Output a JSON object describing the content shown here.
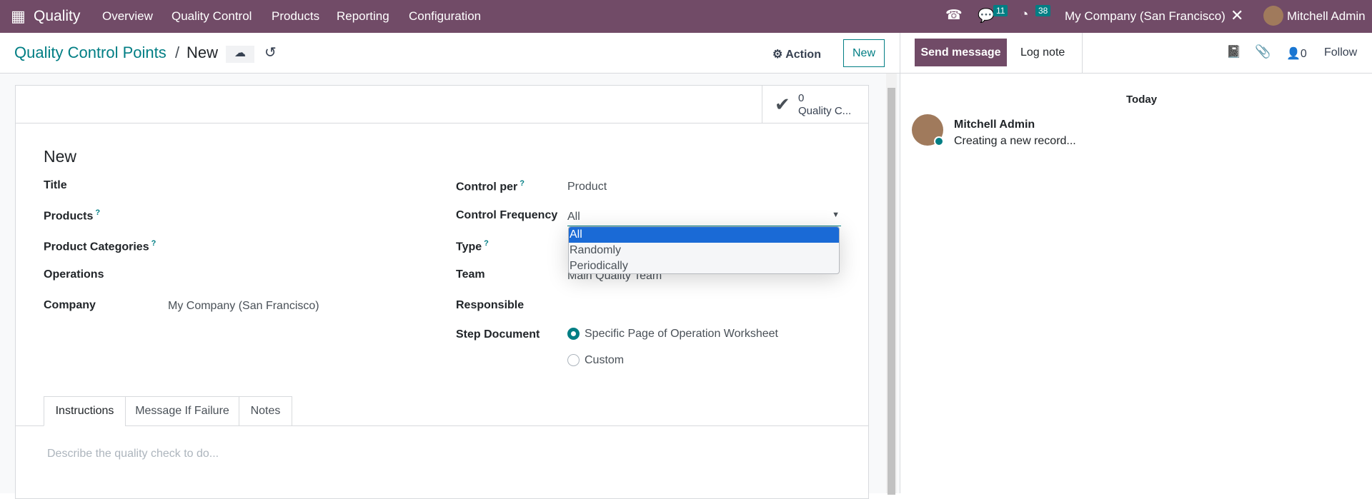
{
  "topbar": {
    "app": "Quality",
    "menu": [
      "Overview",
      "Quality Control",
      "Products",
      "Reporting",
      "Configuration"
    ],
    "messages_count": "11",
    "activities_count": "38",
    "company": "My Company (San Francisco)",
    "user": "Mitchell Admin"
  },
  "breadcrumb": {
    "parent": "Quality Control Points",
    "current": "New"
  },
  "actions": {
    "action": "Action",
    "new": "New"
  },
  "stat": {
    "count": "0",
    "label": "Quality C..."
  },
  "form": {
    "title": "New",
    "left": [
      {
        "label": "Title",
        "value": ""
      },
      {
        "label": "Products",
        "help": "?",
        "value": ""
      },
      {
        "label": "Product Categories",
        "help": "?",
        "value": ""
      },
      {
        "label": "Operations",
        "value": ""
      },
      {
        "label": "Company",
        "value": "My Company (San Francisco)"
      }
    ],
    "right": {
      "control_per": {
        "label": "Control per",
        "help": "?",
        "value": "Product"
      },
      "control_frequency": {
        "label": "Control Frequency",
        "value": "All",
        "options": [
          "All",
          "Randomly",
          "Periodically"
        ],
        "selected": "All"
      },
      "type": {
        "label": "Type",
        "help": "?"
      },
      "team": {
        "label": "Team",
        "value": "Main Quality Team"
      },
      "responsible": {
        "label": "Responsible",
        "value": ""
      },
      "step_document": {
        "label": "Step Document",
        "options": [
          "Specific Page of Operation Worksheet",
          "Custom"
        ],
        "selected": "Specific Page of Operation Worksheet"
      }
    },
    "tabs": [
      "Instructions",
      "Message If Failure",
      "Notes"
    ],
    "active_tab": "Instructions",
    "placeholder": "Describe the quality check to do..."
  },
  "chatter": {
    "send": "Send message",
    "log": "Log note",
    "followers": "0",
    "follow": "Follow",
    "date": "Today",
    "author": "Mitchell Admin",
    "message": "Creating a new record..."
  },
  "colors": {
    "brand": "#714b67",
    "accent": "#017e84",
    "selection": "#1a6ad6"
  }
}
